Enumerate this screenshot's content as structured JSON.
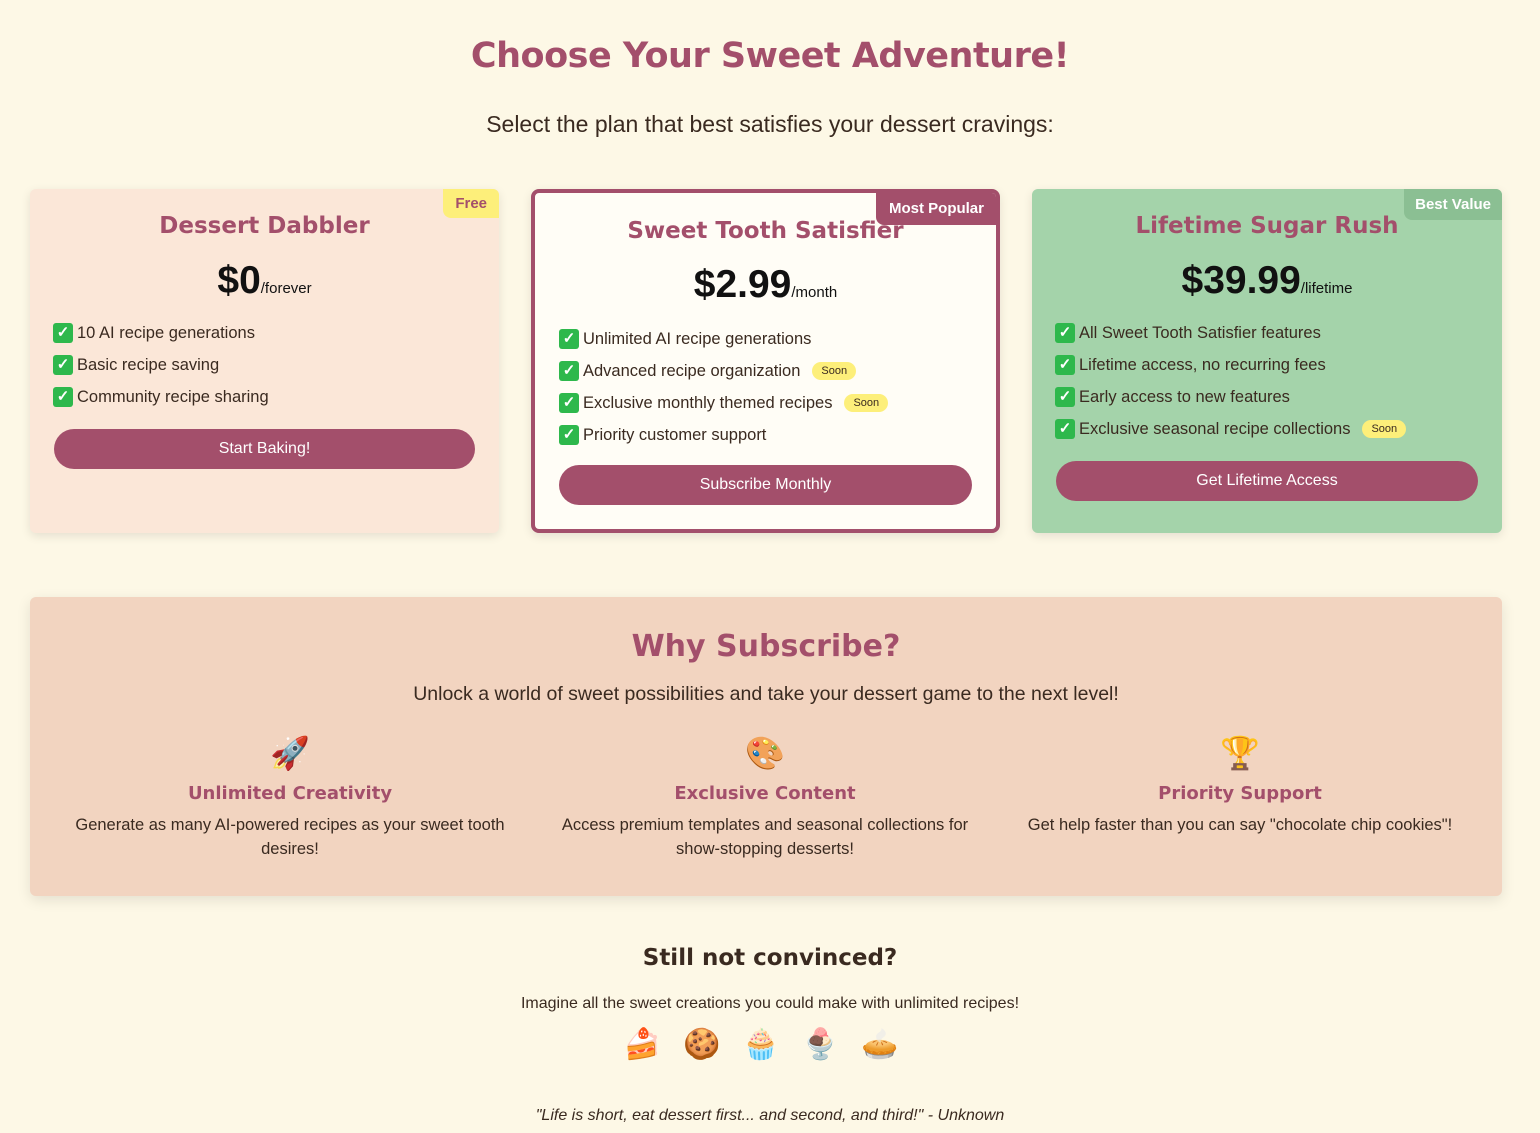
{
  "header": {
    "title": "Choose Your Sweet Adventure!",
    "subtitle": "Select the plan that best satisfies your dessert cravings:"
  },
  "plans": [
    {
      "badge": "Free",
      "name": "Dessert Dabbler",
      "price": "$0",
      "period": "/forever",
      "features": [
        {
          "text": "10 AI recipe generations",
          "soon": ""
        },
        {
          "text": "Basic recipe saving",
          "soon": ""
        },
        {
          "text": "Community recipe sharing",
          "soon": ""
        }
      ],
      "cta": "Start Baking!"
    },
    {
      "badge": "Most Popular",
      "name": "Sweet Tooth Satisfier",
      "price": "$2.99",
      "period": "/month",
      "features": [
        {
          "text": "Unlimited AI recipe generations",
          "soon": ""
        },
        {
          "text": "Advanced recipe organization",
          "soon": "Soon"
        },
        {
          "text": "Exclusive monthly themed recipes",
          "soon": "Soon"
        },
        {
          "text": "Priority customer support",
          "soon": ""
        }
      ],
      "cta": "Subscribe Monthly"
    },
    {
      "badge": "Best Value",
      "name": "Lifetime Sugar Rush",
      "price": "$39.99",
      "period": "/lifetime",
      "features": [
        {
          "text": "All Sweet Tooth Satisfier features",
          "soon": ""
        },
        {
          "text": "Lifetime access, no recurring fees",
          "soon": ""
        },
        {
          "text": "Early access to new features",
          "soon": ""
        },
        {
          "text": "Exclusive seasonal recipe collections",
          "soon": "Soon"
        }
      ],
      "cta": "Get Lifetime Access"
    }
  ],
  "why": {
    "title": "Why Subscribe?",
    "subtitle": "Unlock a world of sweet possibilities and take your dessert game to the next level!",
    "benefits": [
      {
        "icon": "🚀",
        "icon_name": "rocket-icon",
        "title": "Unlimited Creativity",
        "text": "Generate as many AI-powered recipes as your sweet tooth desires!"
      },
      {
        "icon": "🎨",
        "icon_name": "palette-icon",
        "title": "Exclusive Content",
        "text": "Access premium templates and seasonal collections for show-stopping desserts!"
      },
      {
        "icon": "🏆",
        "icon_name": "trophy-icon",
        "title": "Priority Support",
        "text": "Get help faster than you can say \"chocolate chip cookies\"!"
      }
    ]
  },
  "footer": {
    "title": "Still not convinced?",
    "text": "Imagine all the sweet creations you could make with unlimited recipes!",
    "treats": [
      "🍰",
      "🍪",
      "🧁",
      "🍨",
      "🥧"
    ],
    "quote": "\"Life is short, eat dessert first... and second, and third!\" - Unknown"
  },
  "colors": {
    "background": "#fdf8e6",
    "accent": "#a34f6b",
    "free_card": "#fbe7d8",
    "lifetime_card": "#a4d3aa",
    "badge_yellow": "#fdef7a",
    "check_green": "#2eb84c"
  }
}
